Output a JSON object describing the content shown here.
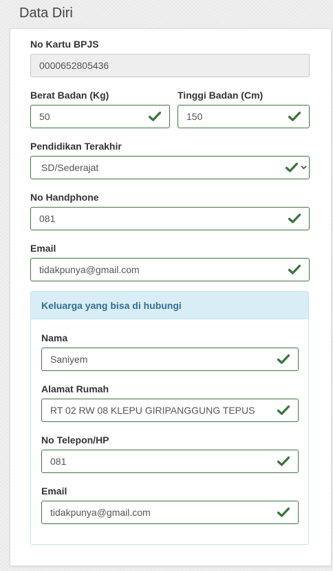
{
  "page": {
    "title": "Data Diri"
  },
  "form": {
    "bpjs": {
      "label": "No Kartu BPJS",
      "value": "0000652805436"
    },
    "weight": {
      "label": "Berat Badan (Kg)",
      "value": "50"
    },
    "height": {
      "label": "Tinggi Badan (Cm)",
      "value": "150"
    },
    "education": {
      "label": "Pendidikan Terakhir",
      "value": "SD/Sederajat"
    },
    "phone": {
      "label": "No Handphone",
      "value": "081"
    },
    "email": {
      "label": "Email",
      "value": "tidakpunya@gmail.com"
    }
  },
  "family_panel": {
    "heading": "Keluarga yang bisa di hubungi",
    "name": {
      "label": "Nama",
      "value": "Saniyem"
    },
    "address": {
      "label": "Alamat Rumah",
      "value": "RT 02 RW 08 KLEPU GIRIPANGGUNG TEPUS"
    },
    "phone": {
      "label": "No Telepon/HP",
      "value": "081"
    },
    "email": {
      "label": "Email",
      "value": "tidakpunya@gmail.com"
    }
  },
  "colors": {
    "success": "#3c763d",
    "panel_heading_bg": "#d9edf7",
    "panel_heading_text": "#31708f",
    "panel_border": "#bce8f1",
    "readonly_bg": "#eeeeee"
  },
  "icons": {
    "valid": "check-icon",
    "select": "chevron-down-icon"
  }
}
